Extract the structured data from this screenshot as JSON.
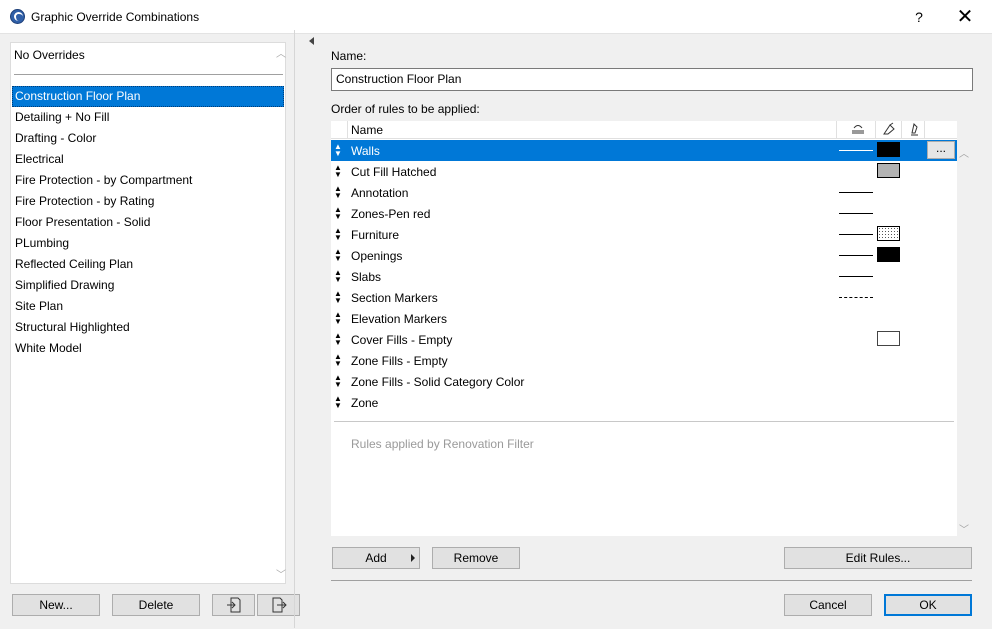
{
  "window": {
    "title": "Graphic Override Combinations",
    "help": "?",
    "close": "✕"
  },
  "left": {
    "no_overrides": "No Overrides",
    "combinations": [
      {
        "label": "Construction Floor Plan",
        "selected": true
      },
      {
        "label": "Detailing + No Fill"
      },
      {
        "label": "Drafting - Color"
      },
      {
        "label": "Electrical"
      },
      {
        "label": "Fire Protection - by Compartment"
      },
      {
        "label": "Fire Protection - by Rating"
      },
      {
        "label": "Floor Presentation - Solid"
      },
      {
        "label": "PLumbing"
      },
      {
        "label": "Reflected Ceiling Plan"
      },
      {
        "label": "Simplified Drawing"
      },
      {
        "label": "Site Plan"
      },
      {
        "label": "Structural Highlighted"
      },
      {
        "label": "White Model"
      }
    ],
    "new_label": "New...",
    "delete_label": "Delete"
  },
  "right": {
    "name_label": "Name:",
    "name_value": "Construction Floor Plan",
    "order_label": "Order of rules to be applied:",
    "column_name": "Name",
    "rules": [
      {
        "name": "Walls",
        "line": "solid",
        "fill": "black",
        "selected": true
      },
      {
        "name": "Cut Fill Hatched",
        "line": "",
        "fill": "hatch-dense"
      },
      {
        "name": "Annotation",
        "line": "solid",
        "fill": ""
      },
      {
        "name": "Zones-Pen red",
        "line": "solid",
        "fill": ""
      },
      {
        "name": "Furniture",
        "line": "solid",
        "fill": "hatch-light"
      },
      {
        "name": "Openings",
        "line": "solid",
        "fill": "black"
      },
      {
        "name": "Slabs",
        "line": "solid",
        "fill": ""
      },
      {
        "name": "Section Markers",
        "line": "dashed",
        "fill": ""
      },
      {
        "name": "Elevation Markers",
        "line": "",
        "fill": ""
      },
      {
        "name": "Cover Fills - Empty",
        "line": "",
        "fill": "empty"
      },
      {
        "name": "Zone Fills - Empty",
        "line": "",
        "fill": ""
      },
      {
        "name": "Zone Fills - Solid Category Color",
        "line": "",
        "fill": ""
      },
      {
        "name": "Zone",
        "line": "",
        "fill": ""
      }
    ],
    "more_label": "...",
    "renovation_text": "Rules applied by Renovation Filter",
    "add_label": "Add",
    "remove_label": "Remove",
    "edit_rules_label": "Edit Rules...",
    "cancel_label": "Cancel",
    "ok_label": "OK"
  },
  "colors": {
    "accent": "#0078d7"
  }
}
